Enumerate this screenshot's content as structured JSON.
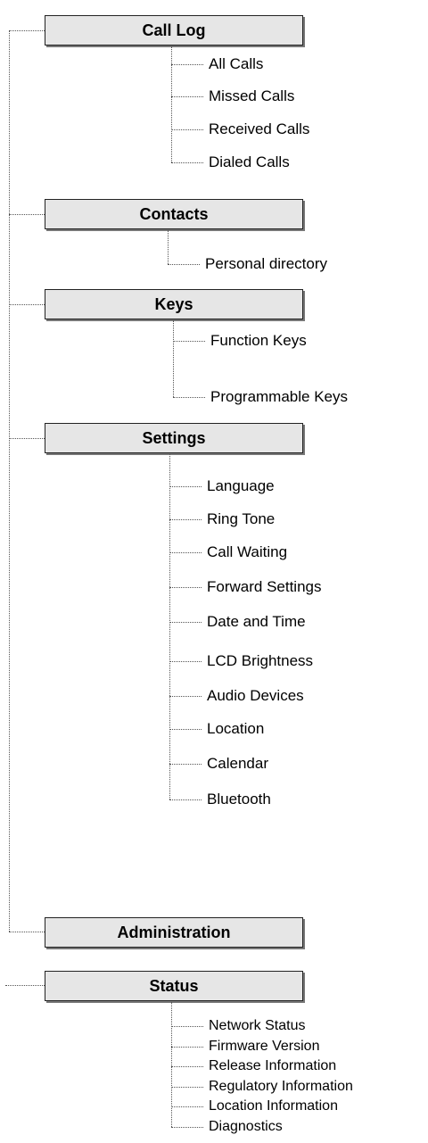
{
  "groups": [
    {
      "title": "Call Log",
      "items": [
        "All Calls",
        "Missed Calls",
        "Received Calls",
        "Dialed Calls"
      ]
    },
    {
      "title": "Contacts",
      "items": [
        "Personal directory"
      ]
    },
    {
      "title": "Keys",
      "items": [
        "Function Keys",
        "Programmable Keys"
      ]
    },
    {
      "title": "Settings",
      "items": [
        "Language",
        "Ring Tone",
        "Call Waiting",
        "Forward Settings",
        "Date and Time",
        "LCD Brightness",
        "Audio Devices",
        "Location",
        "Calendar",
        "Bluetooth"
      ]
    },
    {
      "title": "Administration",
      "items": []
    },
    {
      "title": "Status",
      "items": [
        "Network Status",
        "Firmware Version",
        "Release Information",
        "Regulatory Information",
        "Location Information",
        "Diagnostics"
      ]
    }
  ]
}
